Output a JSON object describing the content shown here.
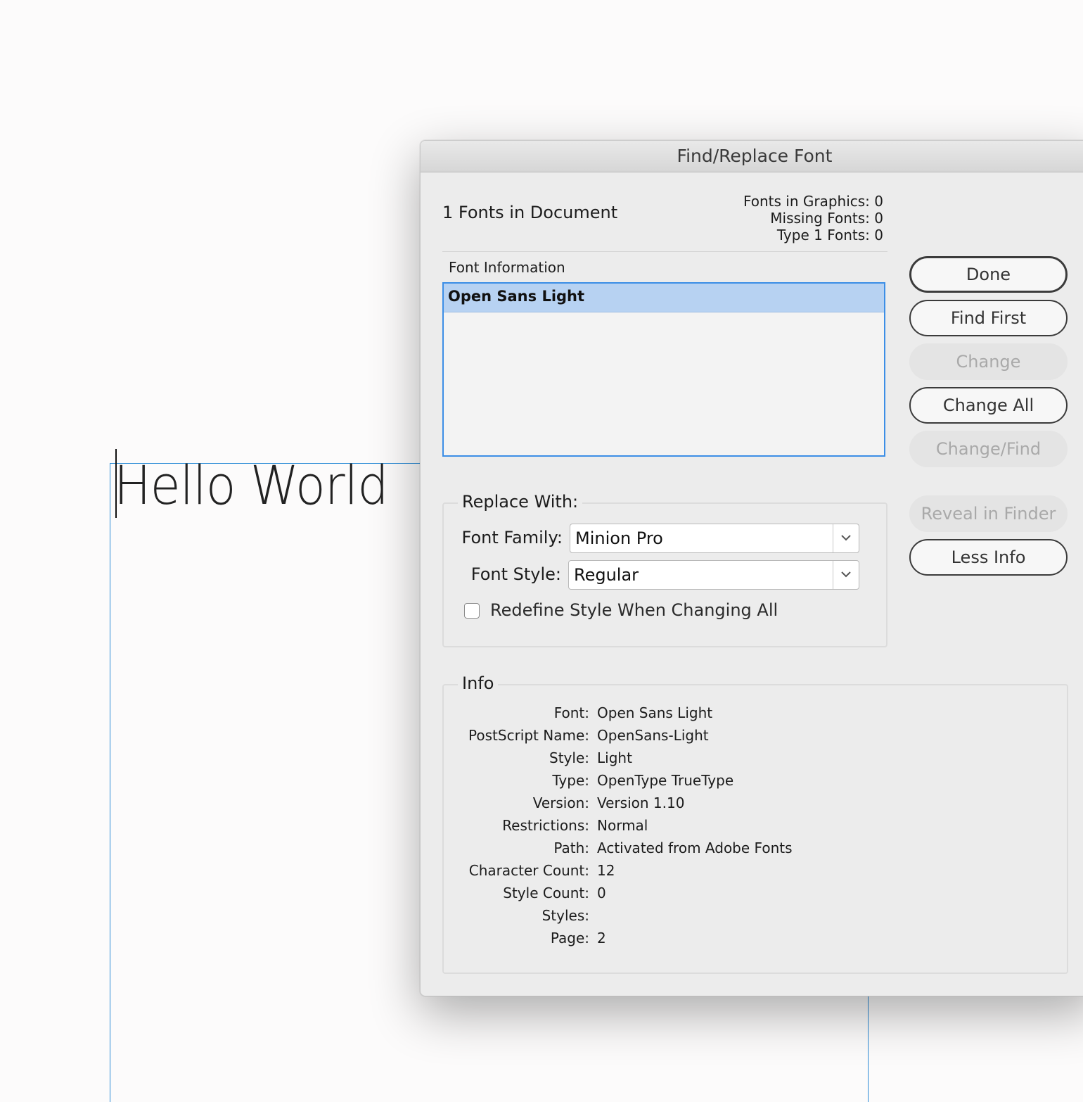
{
  "document": {
    "text": "Hello World"
  },
  "dialog": {
    "title": "Find/Replace Font",
    "fonts_in_document": "1 Fonts in Document",
    "stats": {
      "fonts_in_graphics": "Fonts in Graphics: 0",
      "missing_fonts": "Missing Fonts: 0",
      "type1_fonts": "Type 1 Fonts: 0"
    },
    "font_information_label": "Font Information",
    "font_list": [
      "Open Sans Light"
    ],
    "replace_with": {
      "legend": "Replace With:",
      "font_family_label": "Font Family:",
      "font_family_value": "Minion Pro",
      "font_style_label": "Font Style:",
      "font_style_value": "Regular",
      "redefine_label": "Redefine Style When Changing All",
      "redefine_checked": false
    },
    "buttons": {
      "done": "Done",
      "find_first": "Find First",
      "change": "Change",
      "change_all": "Change All",
      "change_find": "Change/Find",
      "reveal_in_finder": "Reveal in Finder",
      "less_info": "Less Info"
    },
    "info": {
      "legend": "Info",
      "rows": [
        {
          "key": "Font:",
          "value": "Open Sans Light"
        },
        {
          "key": "PostScript Name:",
          "value": "OpenSans-Light"
        },
        {
          "key": "Style:",
          "value": "Light"
        },
        {
          "key": "Type:",
          "value": "OpenType TrueType"
        },
        {
          "key": "Version:",
          "value": "Version 1.10"
        },
        {
          "key": "Restrictions:",
          "value": "Normal"
        },
        {
          "key": "Path:",
          "value": "Activated from Adobe Fonts"
        },
        {
          "key": "Character Count:",
          "value": "12"
        },
        {
          "key": "Style Count:",
          "value": "0"
        },
        {
          "key": "Styles:",
          "value": ""
        },
        {
          "key": "Page:",
          "value": "2"
        }
      ]
    }
  },
  "colors": {
    "selection": "#b7d2f2",
    "focus_ring": "#3c8ee6",
    "guide": "#2a8bd6"
  }
}
